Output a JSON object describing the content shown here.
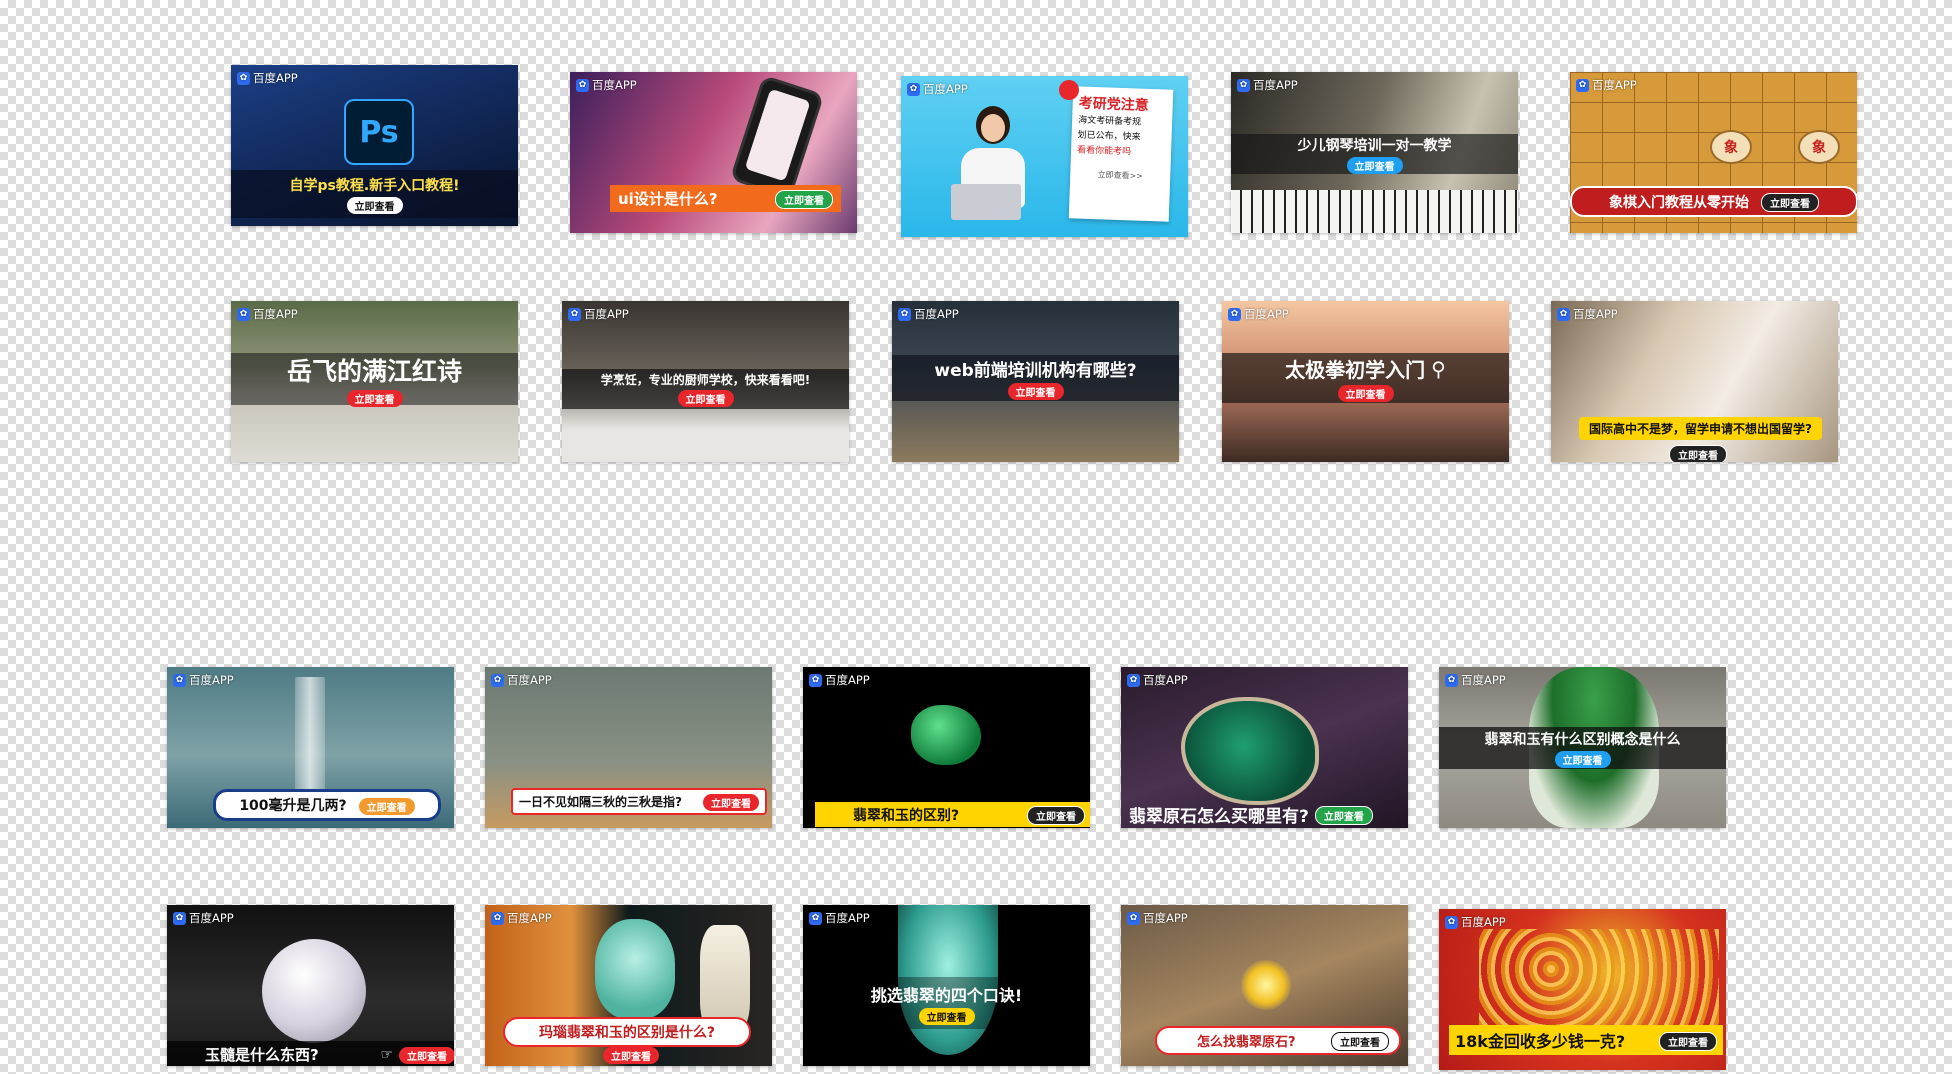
{
  "brand": {
    "name": "百度APP",
    "paw_glyph": "✿",
    "color": "#2e6bf0"
  },
  "rows": [
    [
      {
        "headline": "自学ps教程.新手入口教程!",
        "cta": "立即查看",
        "icon_text": "Ps"
      },
      {
        "headline": "ui设计是什么?",
        "cta": "立即查看"
      },
      {
        "headline_lines": [
          "考研党注意",
          "海文考研备考规",
          "划已公布，快来",
          "看看你能考吗"
        ],
        "cta": "立即查看>>"
      },
      {
        "headline": "少儿钢琴培训一对一教学",
        "cta": "立即查看"
      },
      {
        "headline": "象棋入门教程从零开始",
        "cta": "立即查看",
        "piece_text": "象"
      }
    ],
    [
      {
        "headline": "岳飞的满江红诗",
        "cta": "立即查看"
      },
      {
        "headline": "学烹饪，专业的厨师学校，快来看看吧!",
        "cta": "立即查看"
      },
      {
        "headline": "web前端培训机构有哪些?",
        "cta": "立即查看"
      },
      {
        "headline": "太极拳初学入门",
        "cta": "立即查看"
      },
      {
        "headline": "国际高中不是梦，留学申请不想出国留学?",
        "cta": "立即查看"
      }
    ],
    [
      {
        "headline": "100毫升是几两?",
        "cta": "立即查看"
      },
      {
        "headline": "一日不见如隔三秋的三秋是指?",
        "cta": "立即查看"
      },
      {
        "headline": "翡翠和玉的区别?",
        "cta": "立即查看"
      },
      {
        "headline": "翡翠原石怎么买哪里有?",
        "cta": "立即查看"
      },
      {
        "headline": "翡翠和玉有什么区别概念是什么",
        "cta": "立即查看"
      }
    ],
    [
      {
        "headline": "玉髓是什么东西?",
        "cta": "立即查看"
      },
      {
        "headline": "玛瑙翡翠和玉的区别是什么?",
        "cta": "立即查看"
      },
      {
        "headline": "挑选翡翠的四个口诀!",
        "cta": "立即查看"
      },
      {
        "headline": "怎么找翡翠原石?",
        "cta": "立即查看"
      },
      {
        "headline": "18k金回收多少钱一克?",
        "cta": "立即查看"
      }
    ]
  ],
  "colors": {
    "accent_red": "#e8262b",
    "accent_orange": "#f26b1d",
    "highlight_yellow": "#ffd400"
  }
}
